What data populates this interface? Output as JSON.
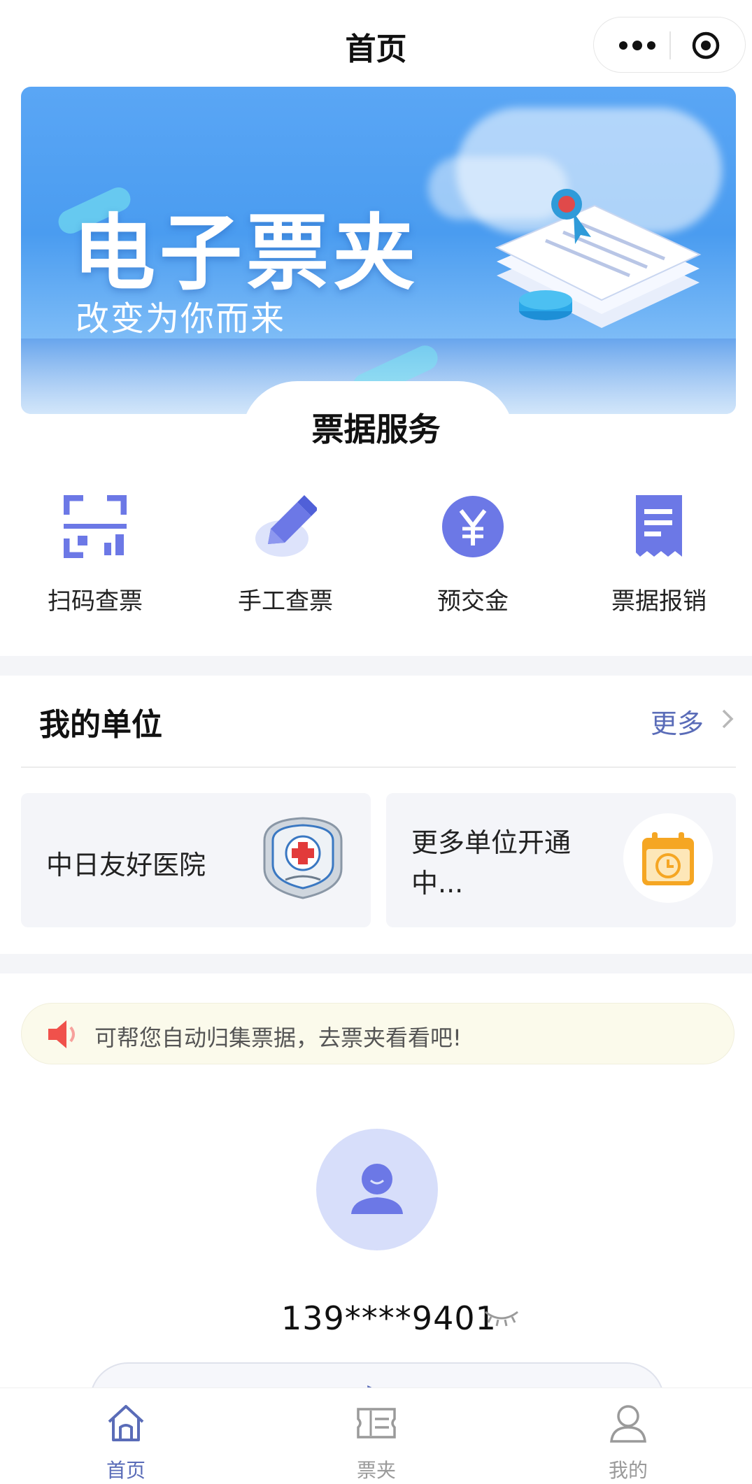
{
  "header": {
    "title": "首页"
  },
  "banner": {
    "headline": "电子票夹",
    "subline": "改变为你而来"
  },
  "services": {
    "title": "票据服务",
    "items": [
      {
        "label": "扫码查票",
        "icon": "scan-icon"
      },
      {
        "label": "手工查票",
        "icon": "pen-icon"
      },
      {
        "label": "预交金",
        "icon": "yuan-icon"
      },
      {
        "label": "票据报销",
        "icon": "receipt-icon"
      }
    ]
  },
  "units": {
    "title": "我的单位",
    "more": "更多",
    "cards": [
      {
        "name": "中日友好医院",
        "icon": "hospital-logo"
      },
      {
        "name": "更多单位开通中...",
        "icon": "calendar-clock-icon"
      }
    ]
  },
  "notice": {
    "text": "可帮您自动归集票据，去票夹看看吧!"
  },
  "user": {
    "phone": "139****9401"
  },
  "tabs": [
    {
      "label": "首页",
      "icon": "home-icon",
      "active": true
    },
    {
      "label": "票夹",
      "icon": "ticket-folder-icon",
      "active": false
    },
    {
      "label": "我的",
      "icon": "user-icon",
      "active": false
    }
  ],
  "colors": {
    "accent": "#5a6cb8",
    "icon_primary": "#6c78e6",
    "notice_bg": "#fbfaeb",
    "speaker_red": "#f0514b",
    "calendar_orange": "#f5a623"
  }
}
